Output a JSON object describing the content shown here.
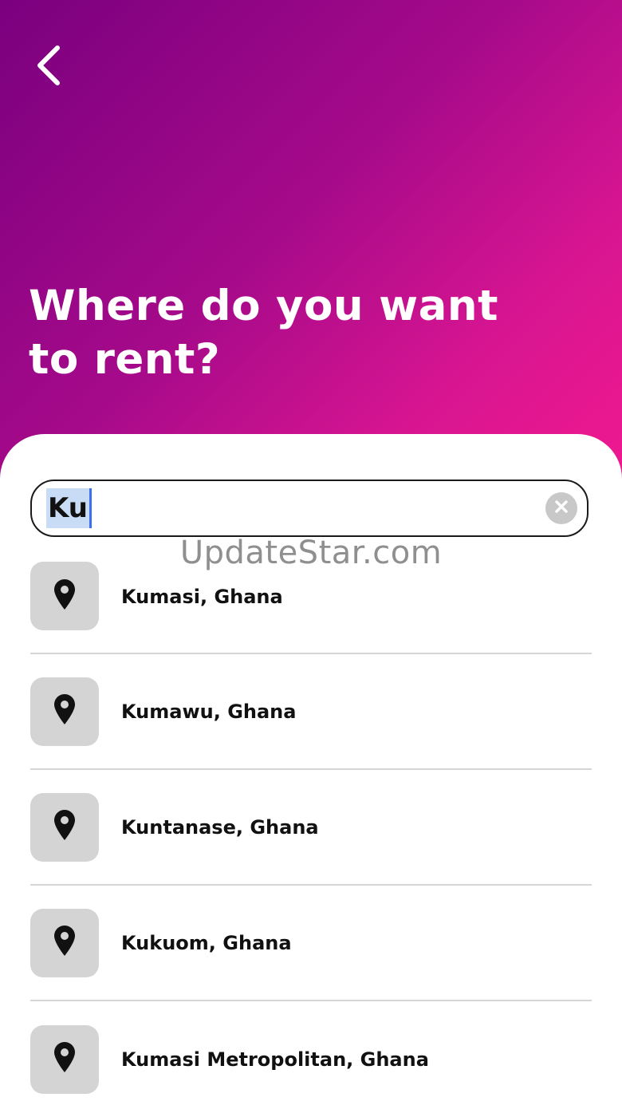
{
  "header": {
    "title": "Where do you want to rent?",
    "back_icon": "chevron-left-icon"
  },
  "colors": {
    "gradient_start": "#7a007f",
    "gradient_end": "#f0198f",
    "tile_bg": "#d4d4d4",
    "selection": "#c9dcf5",
    "caret": "#3a6ff0"
  },
  "search": {
    "value": "Ku",
    "placeholder": "",
    "clear_icon": "clear-x-icon"
  },
  "watermark": "UpdateStar.com",
  "results": [
    {
      "label": "Kumasi, Ghana",
      "icon": "map-pin-icon"
    },
    {
      "label": "Kumawu, Ghana",
      "icon": "map-pin-icon"
    },
    {
      "label": "Kuntanase, Ghana",
      "icon": "map-pin-icon"
    },
    {
      "label": "Kukuom, Ghana",
      "icon": "map-pin-icon"
    },
    {
      "label": "Kumasi Metropolitan, Ghana",
      "icon": "map-pin-icon"
    }
  ]
}
